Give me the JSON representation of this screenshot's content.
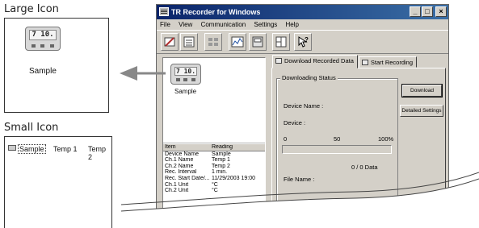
{
  "large_icon": {
    "title": "Large Icon",
    "device_display": "7 10.",
    "caption": "Sample"
  },
  "small_icon": {
    "title": "Small Icon",
    "items": [
      "Sample",
      "Temp 1",
      "Temp 2"
    ]
  },
  "window": {
    "title": "TR Recorder for Windows",
    "controls": {
      "minimize": "_",
      "maximize": "□",
      "close": "×"
    },
    "menu": [
      "File",
      "View",
      "Communication",
      "Settings",
      "Help"
    ],
    "toolbar": [
      "open-icon",
      "list-icon",
      "grid-icon",
      "graph-icon",
      "device-icon",
      "layout-icon",
      "help-icon"
    ],
    "icon_area": {
      "device_display": "7 10.",
      "caption": "Sample"
    },
    "properties": {
      "headers": [
        "Item",
        "Reading"
      ],
      "rows": [
        [
          "Device Name",
          "Sample"
        ],
        [
          "Ch.1 Name",
          "Temp 1"
        ],
        [
          "Ch.2 Name",
          "Temp 2"
        ],
        [
          "Rec. Interval",
          "1 min."
        ],
        [
          "Rec. Start Date/...",
          "11/29/2003 19:00"
        ],
        [
          "Ch.1 Unit",
          "°C"
        ],
        [
          "Ch.2 Unit",
          "°C"
        ]
      ]
    },
    "tabs": [
      {
        "label": "Download Recorded Data",
        "active": true
      },
      {
        "label": "Start Recording",
        "active": false
      }
    ],
    "download": {
      "group_label": "Downloading Status",
      "device_name_label": "Device Name :",
      "device_label": "Device :",
      "scale": [
        "0",
        "50",
        "100%"
      ],
      "progress": 0,
      "count": "0 / 0 Data",
      "file_name_label": "File Name :",
      "download_button": "Download",
      "settings_button": "Detailed Settings"
    }
  }
}
